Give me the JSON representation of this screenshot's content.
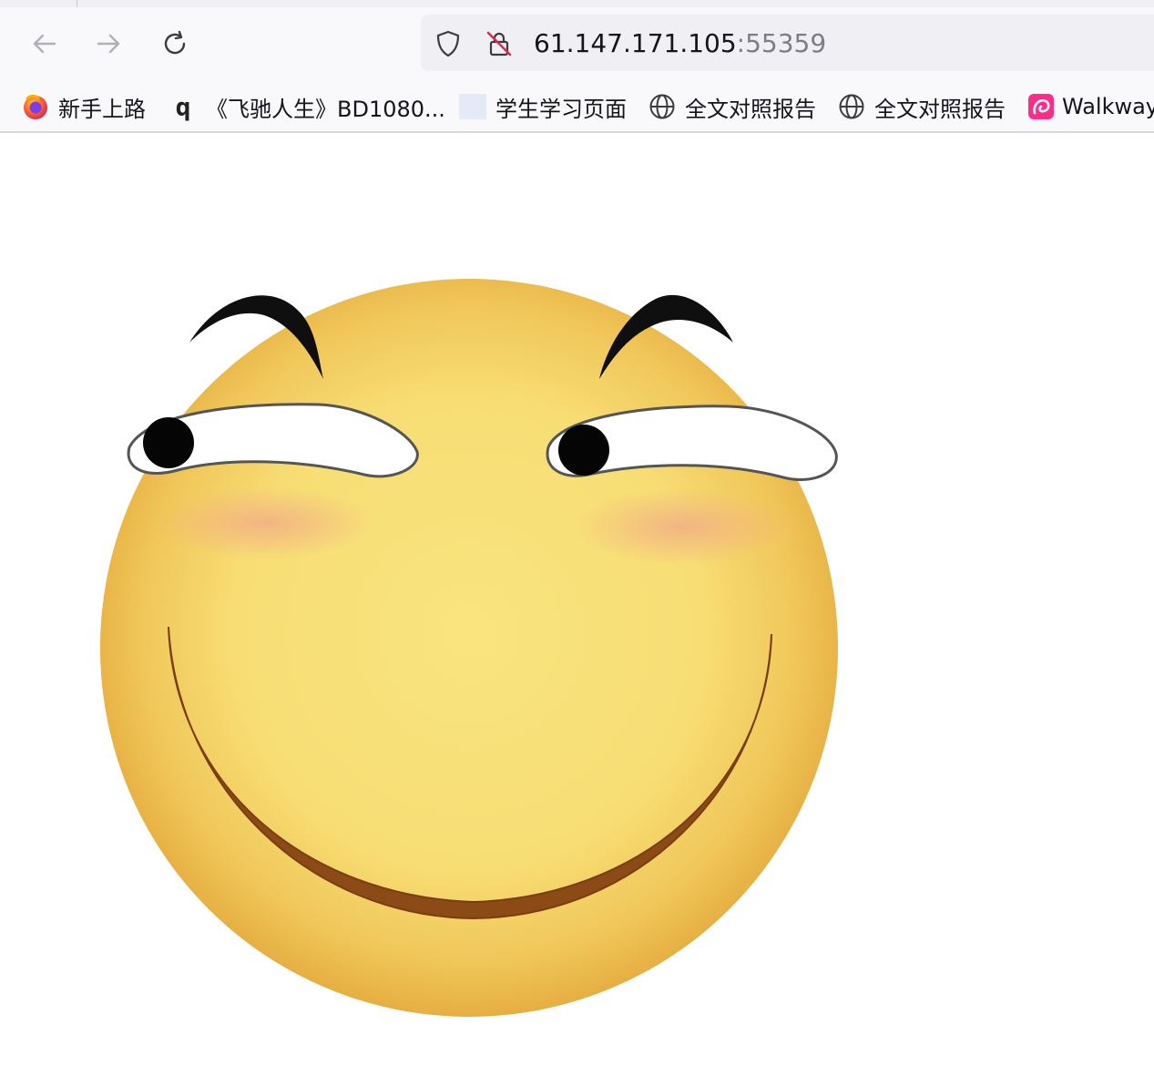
{
  "browser": {
    "url_host": "61.147.171.105",
    "url_port": ":55359",
    "nav": {
      "back_icon": "arrow-left-icon",
      "forward_icon": "arrow-right-icon",
      "reload_icon": "reload-icon"
    },
    "security_icons": [
      "shield-icon",
      "insecure-lock-icon"
    ]
  },
  "bookmarks": [
    {
      "label": "新手上路",
      "icon": "firefox-icon"
    },
    {
      "label": "《飞驰人生》BD1080...",
      "icon": "q-icon"
    },
    {
      "label": "学生学习页面",
      "icon": "blank-favicon"
    },
    {
      "label": "全文对照报告",
      "icon": "globe-icon"
    },
    {
      "label": "全文对照报告",
      "icon": "globe-icon"
    },
    {
      "label": "Walkway",
      "icon": "walkway-icon"
    }
  ],
  "q_glyph": "q",
  "content": {
    "image": "smirking-emoji",
    "colors": {
      "face_center": "#f8e27a",
      "face_edge": "#e9b446",
      "blush": "#f2b48c",
      "mouth": "#8b4a16",
      "brow": "#111111"
    }
  }
}
